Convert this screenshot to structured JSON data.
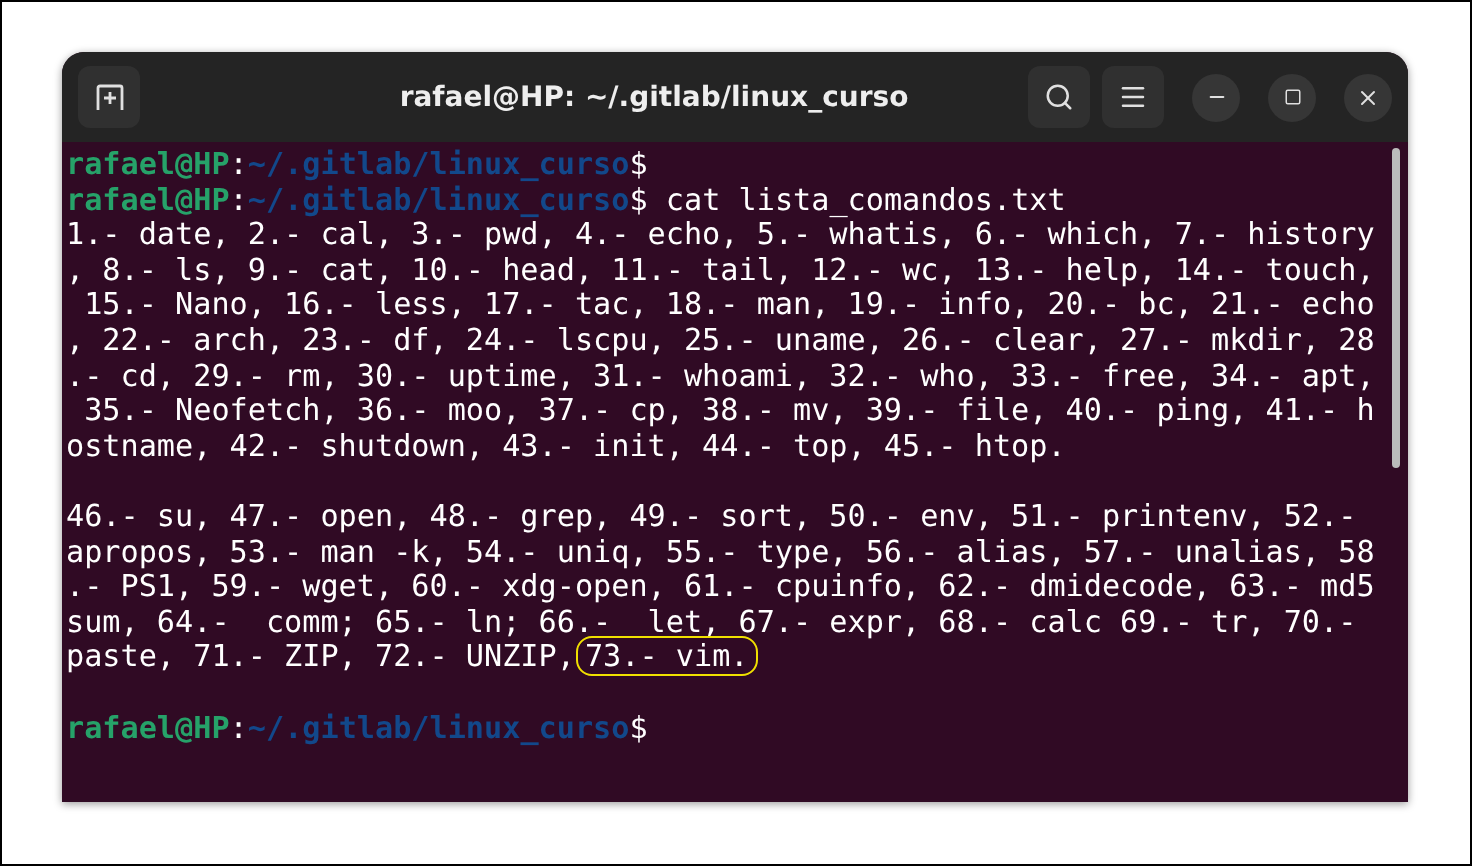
{
  "window": {
    "title": "rafael@HP: ~/.gitlab/linux_curso"
  },
  "terminal": {
    "lines": [
      {
        "kind": "prompt",
        "user": "rafael@HP",
        "separator": ":",
        "path": "~/.gitlab/linux_curso",
        "symbol": "$"
      },
      {
        "kind": "prompt",
        "user": "rafael@HP",
        "separator": ":",
        "path": "~/.gitlab/linux_curso",
        "symbol": "$",
        "command": " cat lista_comandos.txt"
      },
      {
        "kind": "output",
        "text": "1.- date, 2.- cal, 3.- pwd, 4.- echo, 5.- whatis, 6.- which, 7.- history"
      },
      {
        "kind": "output",
        "text": ", 8.- ls, 9.- cat, 10.- head, 11.- tail, 12.- wc, 13.- help, 14.- touch,"
      },
      {
        "kind": "output",
        "text": " 15.- Nano, 16.- less, 17.- tac, 18.- man, 19.- info, 20.- bc, 21.- echo"
      },
      {
        "kind": "output",
        "text": ", 22.- arch, 23.- df, 24.- lscpu, 25.- uname, 26.- clear, 27.- mkdir, 28"
      },
      {
        "kind": "output",
        "text": ".- cd, 29.- rm, 30.- uptime, 31.- whoami, 32.- who, 33.- free, 34.- apt,"
      },
      {
        "kind": "output",
        "text": " 35.- Neofetch, 36.- moo, 37.- cp, 38.- mv, 39.- file, 40.- ping, 41.- h"
      },
      {
        "kind": "output",
        "text": "ostname, 42.- shutdown, 43.- init, 44.- top, 45.- htop."
      },
      {
        "kind": "blank"
      },
      {
        "kind": "output",
        "text": "46.- su, 47.- open, 48.- grep, 49.- sort, 50.- env, 51.- printenv, 52.-"
      },
      {
        "kind": "output",
        "text": "apropos, 53.- man -k, 54.- uniq, 55.- type, 56.- alias, 57.- unalias, 58"
      },
      {
        "kind": "output",
        "text": ".- PS1, 59.- wget, 60.- xdg-open, 61.- cpuinfo, 62.- dmidecode, 63.- md5"
      },
      {
        "kind": "output",
        "text": "sum, 64.-  comm; 65.- ln; 66.-  let, 67.- expr, 68.- calc 69.- tr, 70.-"
      },
      {
        "kind": "output",
        "text": "paste, 71.- ZIP, 72.- UNZIP,",
        "highlight": "73.- vim."
      },
      {
        "kind": "blank"
      },
      {
        "kind": "prompt",
        "user": "rafael@HP",
        "separator": ":",
        "path": "~/.gitlab/linux_curso",
        "symbol": "$"
      }
    ]
  }
}
